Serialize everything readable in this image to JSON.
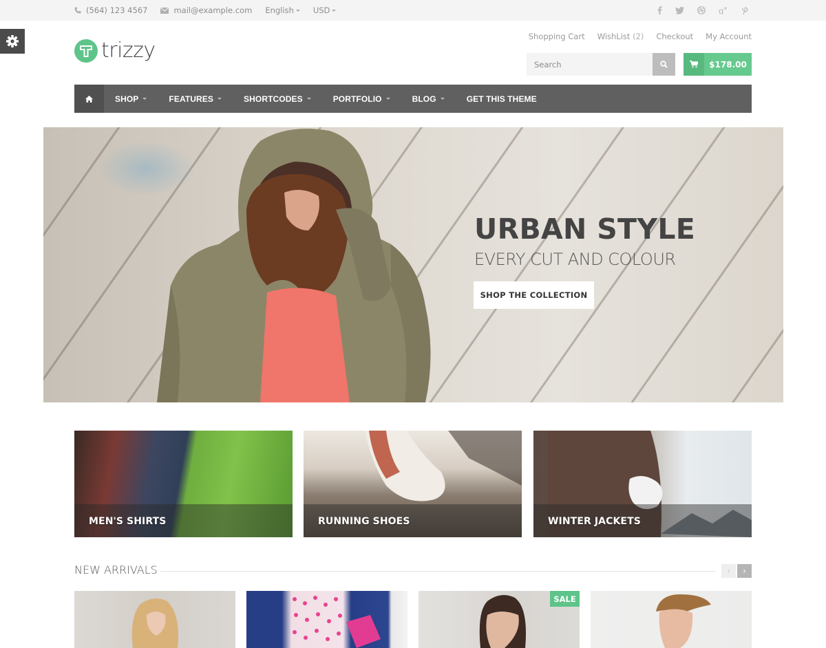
{
  "topbar": {
    "phone": "(564) 123 4567",
    "email": "mail@example.com",
    "language": "English",
    "currency": "USD",
    "social": [
      {
        "name": "facebook",
        "glyph": "f"
      },
      {
        "name": "twitter",
        "glyph": "t"
      },
      {
        "name": "dribbble",
        "glyph": "d"
      },
      {
        "name": "google-plus",
        "glyph": "g+"
      },
      {
        "name": "pinterest",
        "glyph": "p"
      }
    ]
  },
  "header": {
    "logo_text": "trizzy",
    "logo_letter": "T",
    "account_links": {
      "shopping_cart": "Shopping Cart",
      "wishlist": "WishList",
      "wishlist_count": "(2)",
      "checkout": "Checkout",
      "my_account": "My Account"
    },
    "search_placeholder": "Search",
    "cart_total": "$178.00"
  },
  "nav": {
    "items": [
      {
        "label": "SHOP",
        "has_dropdown": true
      },
      {
        "label": "FEATURES",
        "has_dropdown": true
      },
      {
        "label": "SHORTCODES",
        "has_dropdown": true
      },
      {
        "label": "PORTFOLIO",
        "has_dropdown": true
      },
      {
        "label": "BLOG",
        "has_dropdown": true
      },
      {
        "label": "GET THIS THEME",
        "has_dropdown": false
      }
    ]
  },
  "hero": {
    "headline": "URBAN STYLE",
    "subline": "EVERY CUT AND COLOUR",
    "cta": "SHOP THE COLLECTION"
  },
  "categories": [
    {
      "label": "MEN'S SHIRTS"
    },
    {
      "label": "RUNNING SHOES"
    },
    {
      "label": "WINTER JACKETS"
    }
  ],
  "new_arrivals": {
    "title": "NEW ARRIVALS",
    "prev": "‹",
    "next": "›",
    "products": [
      {
        "badge": null
      },
      {
        "badge": null
      },
      {
        "badge": "SALE"
      },
      {
        "badge": null
      }
    ]
  },
  "colors": {
    "accent": "#5ec48a",
    "nav_bg": "#606060",
    "topbar_bg": "#f4f4f4"
  }
}
